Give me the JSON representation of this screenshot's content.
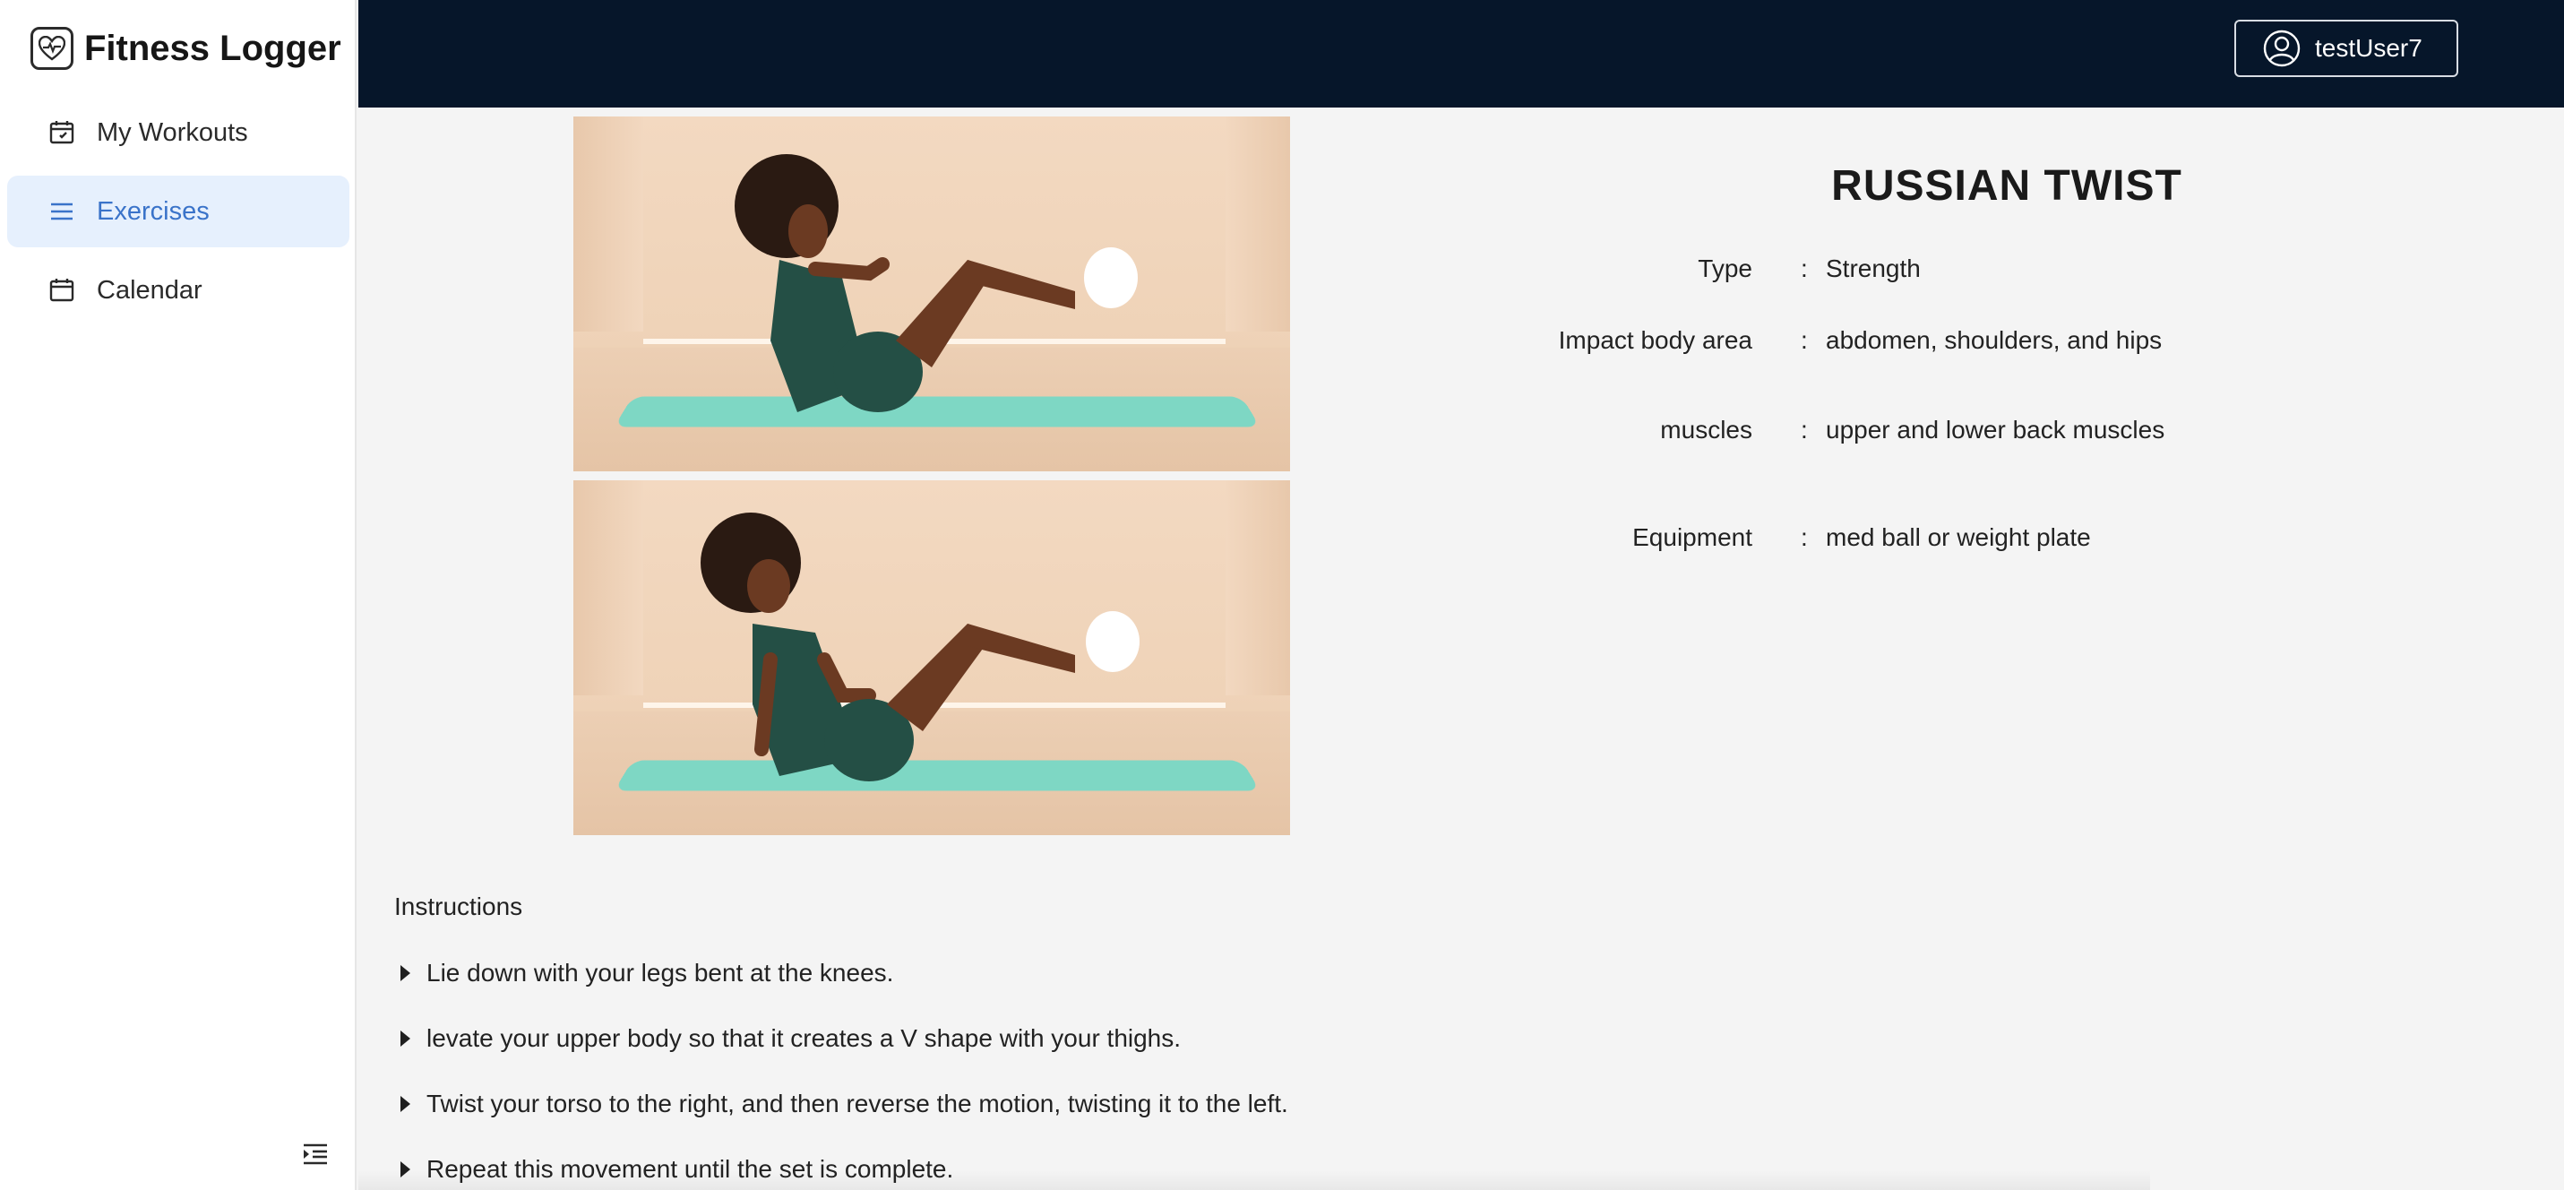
{
  "app": {
    "title": "Fitness Logger"
  },
  "sidebar": {
    "items": [
      {
        "label": "My Workouts",
        "icon": "calendar-check-icon",
        "active": false
      },
      {
        "label": "Exercises",
        "icon": "list-icon",
        "active": true
      },
      {
        "label": "Calendar",
        "icon": "calendar-icon",
        "active": false
      }
    ],
    "collapse_icon": "collapse-sidebar-icon"
  },
  "header": {
    "user": {
      "name": "testUser7",
      "icon": "user-circle-icon"
    }
  },
  "exercise": {
    "name": "RUSSIAN TWIST",
    "details": [
      {
        "key": "Type",
        "sep": ":",
        "value": "Strength"
      },
      {
        "key": "Impact body area",
        "sep": ":",
        "value": "abdomen, shoulders, and hips"
      },
      {
        "key": "muscles",
        "sep": ":",
        "value": "upper and lower back muscles"
      },
      {
        "key": "Equipment",
        "sep": ":",
        "value": "med ball or weight plate"
      }
    ],
    "images": [
      {
        "alt": "russian twist start position"
      },
      {
        "alt": "russian twist twisted position"
      }
    ],
    "instructions_title": "Instructions",
    "instructions": [
      "Lie down with your legs bent at the knees.",
      "levate your upper body so that it creates a V shape with your thighs.",
      "Twist your torso to the right, and then reverse the motion, twisting it to the left.",
      "Repeat this movement until the set is complete."
    ]
  },
  "colors": {
    "header_bg": "#06162a",
    "active_nav_bg": "#e6f0fd",
    "active_nav_text": "#3a73c9",
    "page_bg": "#f4f4f4"
  }
}
